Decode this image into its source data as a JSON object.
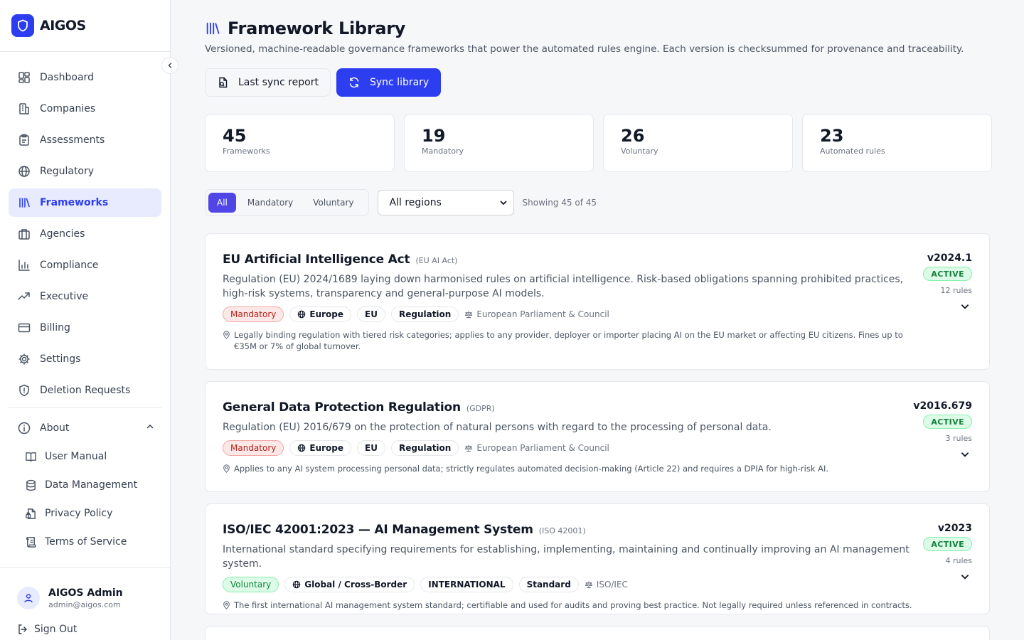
{
  "brand": {
    "name": "AIGOS"
  },
  "sidebar": {
    "items": [
      {
        "label": "Dashboard",
        "icon": "dashboard-icon"
      },
      {
        "label": "Companies",
        "icon": "building-icon"
      },
      {
        "label": "Assessments",
        "icon": "clipboard-icon"
      },
      {
        "label": "Regulatory",
        "icon": "globe-icon"
      },
      {
        "label": "Frameworks",
        "icon": "library-icon",
        "active": true
      },
      {
        "label": "Agencies",
        "icon": "briefcase-icon"
      },
      {
        "label": "Compliance",
        "icon": "bar-chart-icon"
      },
      {
        "label": "Executive",
        "icon": "trending-up-icon"
      },
      {
        "label": "Billing",
        "icon": "credit-card-icon"
      },
      {
        "label": "Settings",
        "icon": "gear-icon"
      },
      {
        "label": "Deletion Requests",
        "icon": "shield-icon"
      }
    ],
    "about": {
      "label": "About",
      "items": [
        {
          "label": "User Manual",
          "icon": "book-icon"
        },
        {
          "label": "Data Management",
          "icon": "database-icon"
        },
        {
          "label": "Privacy Policy",
          "icon": "file-lock-icon"
        },
        {
          "label": "Terms of Service",
          "icon": "scroll-icon"
        }
      ]
    },
    "user": {
      "name": "AIGOS Admin",
      "email": "admin@aigos.com"
    },
    "signout_label": "Sign Out"
  },
  "page": {
    "title": "Framework Library",
    "subtitle": "Versioned, machine-readable governance frameworks that power the automated rules engine. Each version is checksummed for provenance and traceability.",
    "last_sync_label": "Last sync report",
    "sync_label": "Sync library"
  },
  "stats": [
    {
      "value": "45",
      "label": "Frameworks"
    },
    {
      "value": "19",
      "label": "Mandatory"
    },
    {
      "value": "26",
      "label": "Voluntary"
    },
    {
      "value": "23",
      "label": "Automated rules"
    }
  ],
  "filters": {
    "tabs": [
      "All",
      "Mandatory",
      "Voluntary"
    ],
    "active_tab": "All",
    "region": "All regions",
    "showing": "Showing 45 of 45"
  },
  "frameworks": [
    {
      "title": "EU Artificial Intelligence Act",
      "abbr": "(EU AI Act)",
      "description": "Regulation (EU) 2024/1689 laying down harmonised rules on artificial intelligence. Risk-based obligations spanning prohibited practices, high-risk systems, transparency and general-purpose AI models.",
      "type": "Mandatory",
      "region": "Europe",
      "jurisdiction": "EU",
      "category": "Regulation",
      "issuer": "European Parliament & Council",
      "note": "Legally binding regulation with tiered risk categories; applies to any provider, deployer or importer placing AI on the EU market or affecting EU citizens. Fines up to €35M or 7% of global turnover.",
      "version": "v2024.1",
      "status": "ACTIVE",
      "rules": "12 rules"
    },
    {
      "title": "General Data Protection Regulation",
      "abbr": "(GDPR)",
      "description": "Regulation (EU) 2016/679 on the protection of natural persons with regard to the processing of personal data.",
      "type": "Mandatory",
      "region": "Europe",
      "jurisdiction": "EU",
      "category": "Regulation",
      "issuer": "European Parliament & Council",
      "note": "Applies to any AI system processing personal data; strictly regulates automated decision-making (Article 22) and requires a DPIA for high-risk AI.",
      "version": "v2016.679",
      "status": "ACTIVE",
      "rules": "3 rules"
    },
    {
      "title": "ISO/IEC 42001:2023 — AI Management System",
      "abbr": "(ISO 42001)",
      "description": "International standard specifying requirements for establishing, implementing, maintaining and continually improving an AI management system.",
      "type": "Voluntary",
      "region": "Global / Cross-Border",
      "jurisdiction": "INTERNATIONAL",
      "category": "Standard",
      "issuer": "ISO/IEC",
      "note": "The first international AI management system standard; certifiable and used for audits and proving best practice. Not legally required unless referenced in contracts.",
      "version": "v2023",
      "status": "ACTIVE",
      "rules": "4 rules"
    }
  ],
  "colors": {
    "accent": "#2d3ef0",
    "filter_active": "#4f46e5",
    "mandatory": "#b42318",
    "voluntary": "#15803d"
  }
}
